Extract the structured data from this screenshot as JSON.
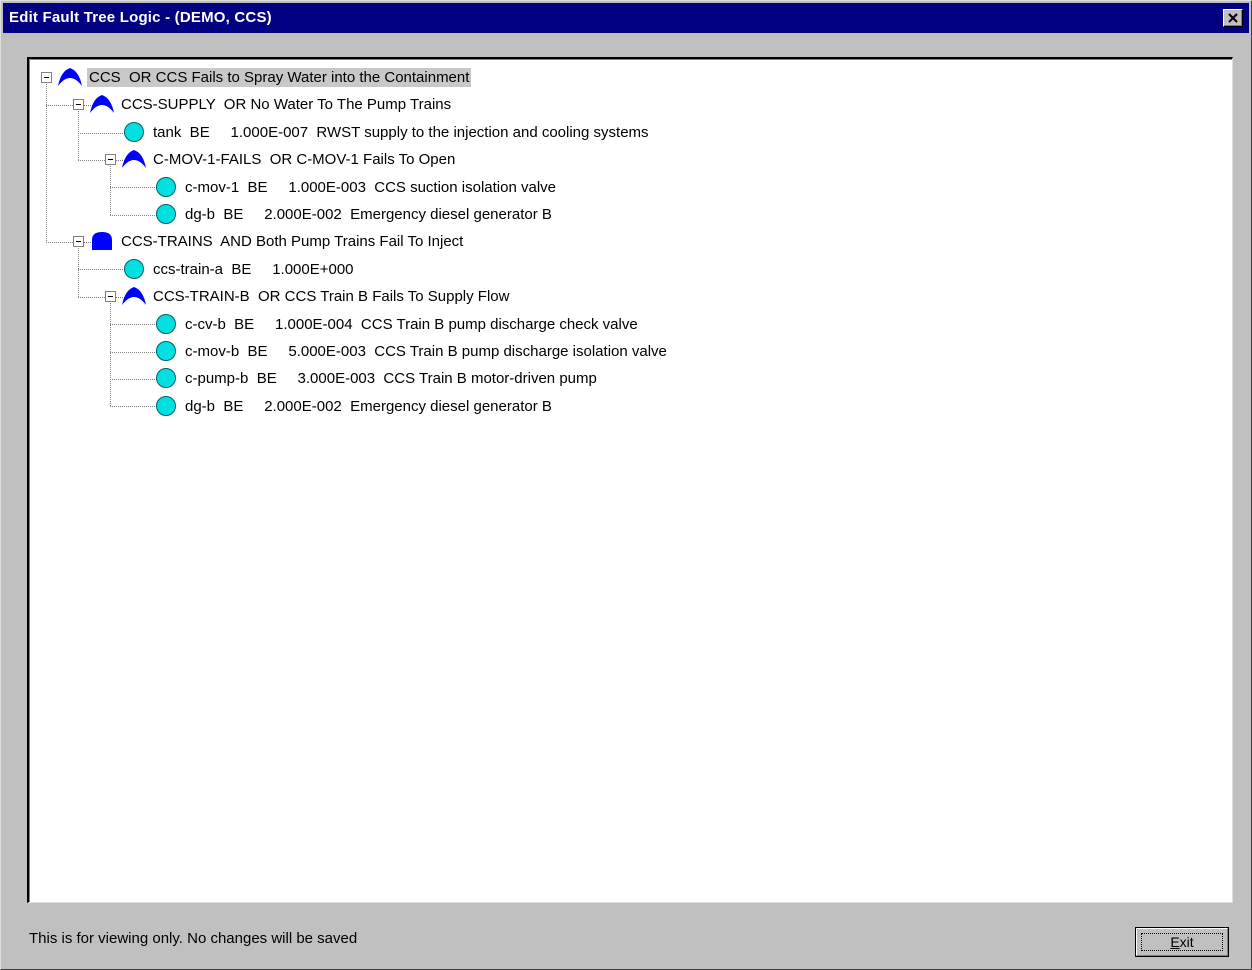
{
  "window": {
    "title": "Edit Fault Tree Logic  -  (DEMO, CCS)"
  },
  "tree": [
    {
      "depth": 0,
      "type": "or-gate",
      "expandable": true,
      "selected": true,
      "label": "CCS  OR CCS Fails to Spray Water into the Containment"
    },
    {
      "depth": 1,
      "type": "or-gate",
      "expandable": true,
      "label": "CCS-SUPPLY  OR No Water To The Pump Trains"
    },
    {
      "depth": 2,
      "type": "basic-event",
      "expandable": false,
      "label": "tank  BE     1.000E-007  RWST supply to the injection and cooling systems"
    },
    {
      "depth": 2,
      "type": "or-gate",
      "expandable": true,
      "label": "C-MOV-1-FAILS  OR C-MOV-1 Fails To Open"
    },
    {
      "depth": 3,
      "type": "basic-event",
      "expandable": false,
      "label": "c-mov-1  BE     1.000E-003  CCS suction isolation valve"
    },
    {
      "depth": 3,
      "type": "basic-event",
      "expandable": false,
      "label": "dg-b  BE     2.000E-002  Emergency diesel generator B"
    },
    {
      "depth": 1,
      "type": "and-gate",
      "expandable": true,
      "label": "CCS-TRAINS  AND Both Pump Trains Fail To Inject"
    },
    {
      "depth": 2,
      "type": "basic-event",
      "expandable": false,
      "label": "ccs-train-a  BE     1.000E+000"
    },
    {
      "depth": 2,
      "type": "or-gate",
      "expandable": true,
      "label": "CCS-TRAIN-B  OR CCS Train B Fails To Supply Flow"
    },
    {
      "depth": 3,
      "type": "basic-event",
      "expandable": false,
      "label": "c-cv-b  BE     1.000E-004  CCS Train B pump discharge check valve"
    },
    {
      "depth": 3,
      "type": "basic-event",
      "expandable": false,
      "label": "c-mov-b  BE     5.000E-003  CCS Train B pump discharge isolation valve"
    },
    {
      "depth": 3,
      "type": "basic-event",
      "expandable": false,
      "label": "c-pump-b  BE     3.000E-003  CCS Train B motor-driven pump"
    },
    {
      "depth": 3,
      "type": "basic-event",
      "expandable": false,
      "label": "dg-b  BE     2.000E-002  Emergency diesel generator B"
    }
  ],
  "footer": {
    "status": "This is for viewing only.  No changes will be saved",
    "exit_accel": "E",
    "exit_rest": "xit"
  },
  "colors": {
    "titlebar": "#000080",
    "gate": "#0000ff",
    "basic_event": "#00e0e0"
  },
  "icons": {
    "or_gate": "or-gate-icon",
    "and_gate": "and-gate-icon",
    "basic_event": "basic-event-icon",
    "expander": "minus-box-icon",
    "close": "close-icon"
  }
}
